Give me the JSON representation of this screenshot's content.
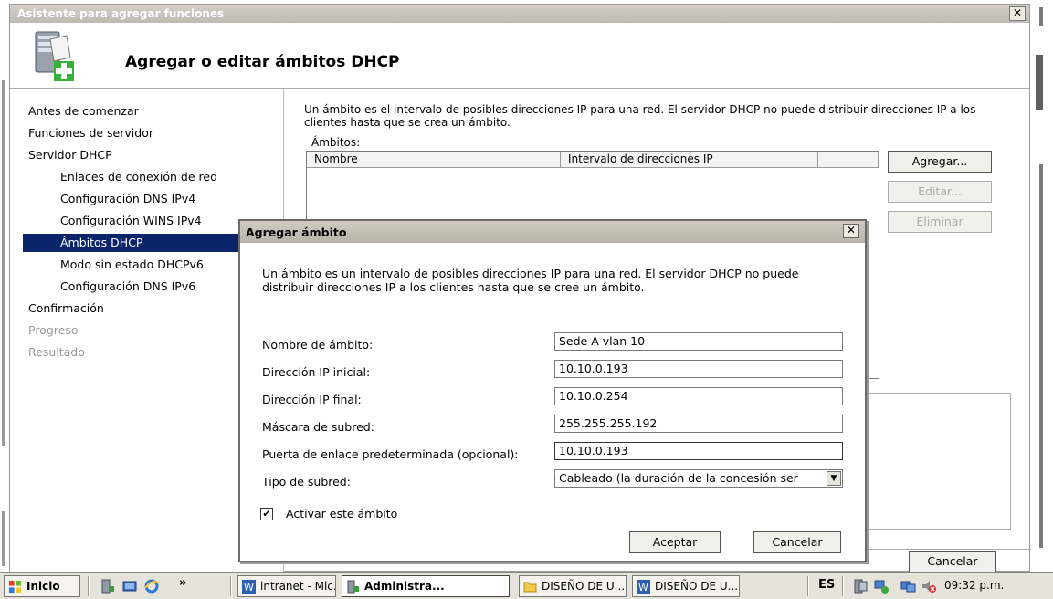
{
  "wizard": {
    "title": "Asistente para agregar funciones",
    "close_glyph": "✕",
    "heading": "Agregar o editar ámbitos DHCP",
    "nav": [
      {
        "label": "Antes de comenzar",
        "state": "normal"
      },
      {
        "label": "Funciones de servidor",
        "state": "normal"
      },
      {
        "label": "Servidor DHCP",
        "state": "normal"
      },
      {
        "label": "Enlaces de conexión de red",
        "state": "sub"
      },
      {
        "label": "Configuración DNS IPv4",
        "state": "sub"
      },
      {
        "label": "Configuración WINS IPv4",
        "state": "sub"
      },
      {
        "label": "Ámbitos DHCP",
        "state": "selected"
      },
      {
        "label": "Modo sin estado DHCPv6",
        "state": "sub"
      },
      {
        "label": "Configuración DNS IPv6",
        "state": "sub"
      },
      {
        "label": "Confirmación",
        "state": "normal"
      },
      {
        "label": "Progreso",
        "state": "disabled"
      },
      {
        "label": "Resultado",
        "state": "disabled"
      }
    ],
    "intro": "Un ámbito es el intervalo de posibles direcciones IP para una red. El servidor DHCP no puede distribuir direcciones IP a los clientes hasta que se crea un ámbito.",
    "list_label": "Ámbitos:",
    "columns": [
      "Nombre",
      "Intervalo de direcciones IP"
    ],
    "buttons": {
      "add": "Agregar...",
      "edit": "Editar...",
      "delete": "Eliminar",
      "cancel": "Cancelar"
    }
  },
  "dialog": {
    "title": "Agregar ámbito",
    "close_glyph": "✕",
    "description": "Un ámbito es un intervalo de posibles direcciones IP para una red. El servidor DHCP no puede distribuir direcciones IP a los clientes hasta que se cree un ámbito.",
    "fields": [
      {
        "label": "Nombre de ámbito:",
        "value": "Sede A vlan 10"
      },
      {
        "label": "Dirección IP inicial:",
        "value": "10.10.0.193"
      },
      {
        "label": "Dirección IP final:",
        "value": "10.10.0.254"
      },
      {
        "label": "Máscara de subred:",
        "value": "255.255.255.192"
      },
      {
        "label": "Puerta de enlace predeterminada (opcional):",
        "value": "10.10.0.193"
      },
      {
        "label": "Tipo de subred:",
        "value": "Cableado (la duración de la concesión ser"
      }
    ],
    "activate_label": "Activar este ámbito",
    "activate_checked": true,
    "check_glyph": "✔",
    "dropdown_glyph": "▼",
    "ok": "Aceptar",
    "cancel": "Cancelar"
  },
  "taskbar": {
    "start": "Inicio",
    "overflow": "»",
    "items": [
      {
        "label": "intranet - Mic...",
        "icon": "word-icon",
        "active": false
      },
      {
        "label": "Administra...",
        "icon": "server-manager-icon",
        "active": true
      },
      {
        "label": "DISEÑO DE U...",
        "icon": "folder-icon",
        "active": false
      },
      {
        "label": "DISEÑO DE U...",
        "icon": "word-icon",
        "active": false
      }
    ],
    "language": "ES",
    "clock": "09:32 p.m."
  },
  "colors": {
    "selection": "#0a246a",
    "title_gradient": "#c9c5bc"
  }
}
